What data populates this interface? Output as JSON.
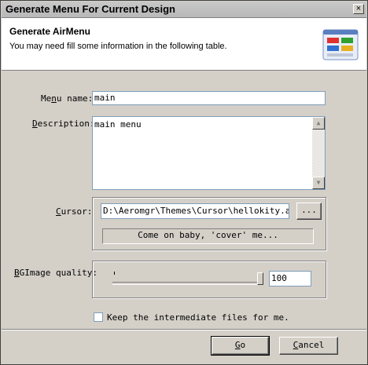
{
  "window": {
    "title": "Generate Menu For Current Design",
    "close_glyph": "×"
  },
  "header": {
    "title": "Generate AirMenu",
    "subtitle": "You may need fill some information in the following table.",
    "icon": "menu-grid-icon"
  },
  "form": {
    "menu_name": {
      "label_before": "Me",
      "label_accel": "n",
      "label_after": "u name:",
      "value": "main"
    },
    "description": {
      "label_accel": "D",
      "label_after": "escription:",
      "value": "main menu"
    },
    "cursor": {
      "label_accel": "C",
      "label_after": "ursor:",
      "value": "D:\\Aeromgr\\Themes\\Cursor\\hellokity.amt",
      "browse_label": "...",
      "preview_text": "Come on baby, 'cover' me..."
    },
    "bgimage_quality": {
      "label_accel": "B",
      "label_after": "GImage quality:",
      "value": "100",
      "slider_fraction": 1.0
    },
    "keep_files": {
      "label": "Keep the intermediate files for me.",
      "checked": false
    }
  },
  "buttons": {
    "go": {
      "label_accel": "G",
      "label_after": "o"
    },
    "cancel": {
      "label_accel": "C",
      "label_after": "ancel"
    }
  },
  "scroll": {
    "up_glyph": "▲",
    "down_glyph": "▼"
  }
}
